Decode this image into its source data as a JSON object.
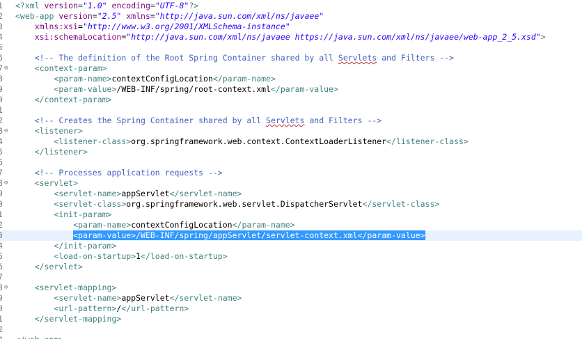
{
  "editor": {
    "language": "xml",
    "selected_line": 23,
    "colors": {
      "tag": "#3f7f7f",
      "attribute": "#7f007f",
      "value": "#2a00ff",
      "comment": "#3f5fbf",
      "text": "#000000",
      "selection": "#3399ff",
      "current_line": "#e8f2fe",
      "line_number": "#787878"
    },
    "lines": [
      {
        "num": "1",
        "fold": "",
        "tokens": [
          {
            "t": "pi",
            "v": "<?xml "
          },
          {
            "t": "attr",
            "v": "version"
          },
          {
            "t": "pi",
            "v": "="
          },
          {
            "t": "val",
            "v": "\"1.0\""
          },
          {
            "t": "pi",
            "v": " "
          },
          {
            "t": "attr",
            "v": "encoding"
          },
          {
            "t": "pi",
            "v": "="
          },
          {
            "t": "val",
            "v": "\"UTF-8\""
          },
          {
            "t": "pi",
            "v": "?>"
          }
        ]
      },
      {
        "num": "2",
        "fold": "",
        "tokens": [
          {
            "t": "tag",
            "v": "<web-app "
          },
          {
            "t": "attr",
            "v": "version"
          },
          {
            "t": "txt",
            "v": "="
          },
          {
            "t": "val",
            "v": "\"2.5\""
          },
          {
            "t": "txt",
            "v": " "
          },
          {
            "t": "attr",
            "v": "xmlns"
          },
          {
            "t": "txt",
            "v": "="
          },
          {
            "t": "val",
            "v": "\"http://java.sun.com/xml/ns/javaee\""
          }
        ]
      },
      {
        "num": "3",
        "fold": "",
        "tokens": [
          {
            "t": "txt",
            "v": "    "
          },
          {
            "t": "attr",
            "v": "xmlns:xsi"
          },
          {
            "t": "txt",
            "v": "="
          },
          {
            "t": "val",
            "v": "\"http://www.w3.org/2001/XMLSchema-instance\""
          }
        ]
      },
      {
        "num": "4",
        "fold": "",
        "tokens": [
          {
            "t": "txt",
            "v": "    "
          },
          {
            "t": "attr",
            "v": "xsi:schemaLocation"
          },
          {
            "t": "txt",
            "v": "="
          },
          {
            "t": "val",
            "v": "\"http://java.sun.com/xml/ns/javaee https://java.sun.com/xml/ns/javaee/web-app_2_5.xsd\""
          },
          {
            "t": "tag",
            "v": ">"
          }
        ]
      },
      {
        "num": "5",
        "fold": "",
        "tokens": []
      },
      {
        "num": "6",
        "fold": "",
        "tokens": [
          {
            "t": "txt",
            "v": "    "
          },
          {
            "t": "cm",
            "v": "<!-- The definition of the Root Spring Container shared by all "
          },
          {
            "t": "cmsq",
            "v": "Servlets"
          },
          {
            "t": "cm",
            "v": " and Filters -->"
          }
        ]
      },
      {
        "num": "7",
        "fold": "⊖",
        "tokens": [
          {
            "t": "txt",
            "v": "    "
          },
          {
            "t": "tag",
            "v": "<context-param>"
          }
        ]
      },
      {
        "num": "8",
        "fold": "",
        "tokens": [
          {
            "t": "txt",
            "v": "        "
          },
          {
            "t": "tag",
            "v": "<param-name>"
          },
          {
            "t": "txt",
            "v": "contextConfigLocation"
          },
          {
            "t": "tag",
            "v": "</param-name>"
          }
        ]
      },
      {
        "num": "9",
        "fold": "",
        "tokens": [
          {
            "t": "txt",
            "v": "        "
          },
          {
            "t": "tag",
            "v": "<param-value>"
          },
          {
            "t": "txt",
            "v": "/WEB-INF/spring/root-context.xml"
          },
          {
            "t": "tag",
            "v": "</param-value>"
          }
        ]
      },
      {
        "num": "0",
        "fold": "",
        "tokens": [
          {
            "t": "txt",
            "v": "    "
          },
          {
            "t": "tag",
            "v": "</context-param>"
          }
        ]
      },
      {
        "num": "1",
        "fold": "",
        "tokens": []
      },
      {
        "num": "2",
        "fold": "",
        "tokens": [
          {
            "t": "txt",
            "v": "    "
          },
          {
            "t": "cm",
            "v": "<!-- Creates the Spring Container shared by all "
          },
          {
            "t": "cmsq",
            "v": "Servlets"
          },
          {
            "t": "cm",
            "v": " and Filters -->"
          }
        ]
      },
      {
        "num": "3",
        "fold": "⊖",
        "tokens": [
          {
            "t": "txt",
            "v": "    "
          },
          {
            "t": "tag",
            "v": "<listener>"
          }
        ]
      },
      {
        "num": "4",
        "fold": "",
        "tokens": [
          {
            "t": "txt",
            "v": "        "
          },
          {
            "t": "tag",
            "v": "<listener-class>"
          },
          {
            "t": "txt",
            "v": "org.springframework.web.context.ContextLoaderListener"
          },
          {
            "t": "tag",
            "v": "</listener-class>"
          }
        ]
      },
      {
        "num": "5",
        "fold": "",
        "tokens": [
          {
            "t": "txt",
            "v": "    "
          },
          {
            "t": "tag",
            "v": "</listener>"
          }
        ]
      },
      {
        "num": "6",
        "fold": "",
        "tokens": []
      },
      {
        "num": "7",
        "fold": "",
        "tokens": [
          {
            "t": "txt",
            "v": "    "
          },
          {
            "t": "cm",
            "v": "<!-- Processes application requests -->"
          }
        ]
      },
      {
        "num": "8",
        "fold": "⊖",
        "tokens": [
          {
            "t": "txt",
            "v": "    "
          },
          {
            "t": "tag",
            "v": "<servlet>"
          }
        ]
      },
      {
        "num": "9",
        "fold": "",
        "tokens": [
          {
            "t": "txt",
            "v": "        "
          },
          {
            "t": "tag",
            "v": "<servlet-name>"
          },
          {
            "t": "txt",
            "v": "appServlet"
          },
          {
            "t": "tag",
            "v": "</servlet-name>"
          }
        ]
      },
      {
        "num": "0",
        "fold": "",
        "tokens": [
          {
            "t": "txt",
            "v": "        "
          },
          {
            "t": "tag",
            "v": "<servlet-class>"
          },
          {
            "t": "txt",
            "v": "org.springframework.web.servlet.DispatcherServlet"
          },
          {
            "t": "tag",
            "v": "</servlet-class>"
          }
        ]
      },
      {
        "num": "1",
        "fold": "",
        "tokens": [
          {
            "t": "txt",
            "v": "        "
          },
          {
            "t": "tag",
            "v": "<init-param>"
          }
        ]
      },
      {
        "num": "2",
        "fold": "",
        "tokens": [
          {
            "t": "txt",
            "v": "            "
          },
          {
            "t": "tag",
            "v": "<param-name>"
          },
          {
            "t": "txt",
            "v": "contextConfigLocation"
          },
          {
            "t": "tag",
            "v": "</param-name>"
          }
        ]
      },
      {
        "num": "3",
        "fold": "",
        "selected": true,
        "tokens": [
          {
            "t": "txt",
            "v": "            "
          },
          {
            "t": "sel",
            "v": "<param-value>/WEB-INF/spring/appServlet/servlet-context.xml</param-value>"
          }
        ]
      },
      {
        "num": "4",
        "fold": "",
        "tokens": [
          {
            "t": "txt",
            "v": "        "
          },
          {
            "t": "tag",
            "v": "</init-param>"
          }
        ]
      },
      {
        "num": "5",
        "fold": "",
        "tokens": [
          {
            "t": "txt",
            "v": "        "
          },
          {
            "t": "tag",
            "v": "<load-on-startup>"
          },
          {
            "t": "txt",
            "v": "1"
          },
          {
            "t": "tag",
            "v": "</load-on-startup>"
          }
        ]
      },
      {
        "num": "6",
        "fold": "",
        "tokens": [
          {
            "t": "txt",
            "v": "    "
          },
          {
            "t": "tag",
            "v": "</servlet>"
          }
        ]
      },
      {
        "num": "7",
        "fold": "",
        "tokens": []
      },
      {
        "num": "8",
        "fold": "⊖",
        "tokens": [
          {
            "t": "txt",
            "v": "    "
          },
          {
            "t": "tag",
            "v": "<servlet-mapping>"
          }
        ]
      },
      {
        "num": "9",
        "fold": "",
        "tokens": [
          {
            "t": "txt",
            "v": "        "
          },
          {
            "t": "tag",
            "v": "<servlet-name>"
          },
          {
            "t": "txt",
            "v": "appServlet"
          },
          {
            "t": "tag",
            "v": "</servlet-name>"
          }
        ]
      },
      {
        "num": "0",
        "fold": "",
        "tokens": [
          {
            "t": "txt",
            "v": "        "
          },
          {
            "t": "tag",
            "v": "<url-pattern>"
          },
          {
            "t": "txt",
            "v": "/"
          },
          {
            "t": "tag",
            "v": "</url-pattern>"
          }
        ]
      },
      {
        "num": "1",
        "fold": "",
        "tokens": [
          {
            "t": "txt",
            "v": "    "
          },
          {
            "t": "tag",
            "v": "</servlet-mapping>"
          }
        ]
      },
      {
        "num": "2",
        "fold": "",
        "tokens": []
      },
      {
        "num": "3",
        "fold": "",
        "tokens": [
          {
            "t": "tag",
            "v": "</web-app>"
          }
        ]
      }
    ]
  }
}
